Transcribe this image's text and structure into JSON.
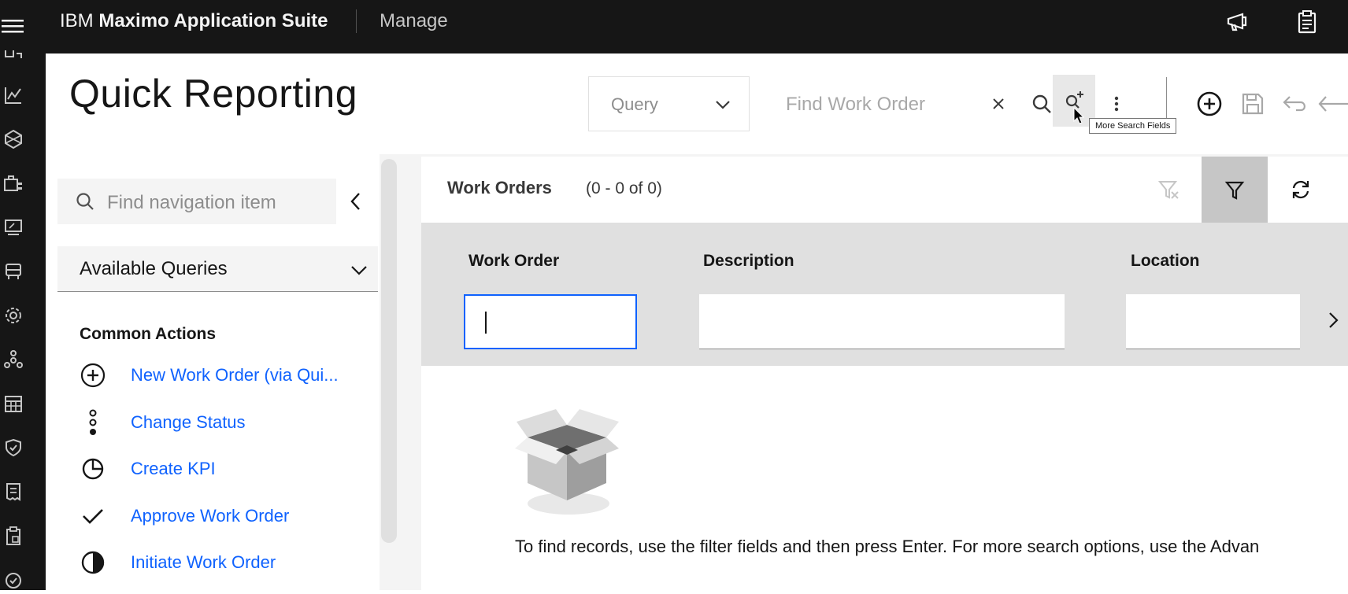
{
  "topbar": {
    "brand_prefix": "IBM",
    "brand_name": "Maximo Application Suite",
    "app_name": "Manage"
  },
  "header": {
    "page_title": "Quick Reporting",
    "query_select_value": "Query",
    "find_placeholder": "Find Work Order",
    "tooltip": "More Search Fields"
  },
  "sidebar": {
    "nav_search_placeholder": "Find navigation item",
    "available_queries_label": "Available Queries",
    "common_actions_title": "Common Actions",
    "actions": [
      {
        "label": "New Work Order (via Qui...",
        "icon": "add-circle-icon"
      },
      {
        "label": "Change Status",
        "icon": "status-dots-icon"
      },
      {
        "label": "Create KPI",
        "icon": "pie-chart-icon"
      },
      {
        "label": "Approve Work Order",
        "icon": "checkmark-icon"
      },
      {
        "label": "Initiate Work Order",
        "icon": "half-circle-icon"
      }
    ]
  },
  "table": {
    "title": "Work Orders",
    "count": "(0 - 0 of 0)",
    "columns": [
      "Work Order",
      "Description",
      "Location"
    ],
    "empty_message": "To find records, use the filter fields and then press Enter. For more search options, use the Advan"
  },
  "colors": {
    "topbar_bg": "#161616",
    "link": "#0f62fe",
    "focus_border": "#0f62fe",
    "filter_row_bg": "#e0e0e0"
  }
}
